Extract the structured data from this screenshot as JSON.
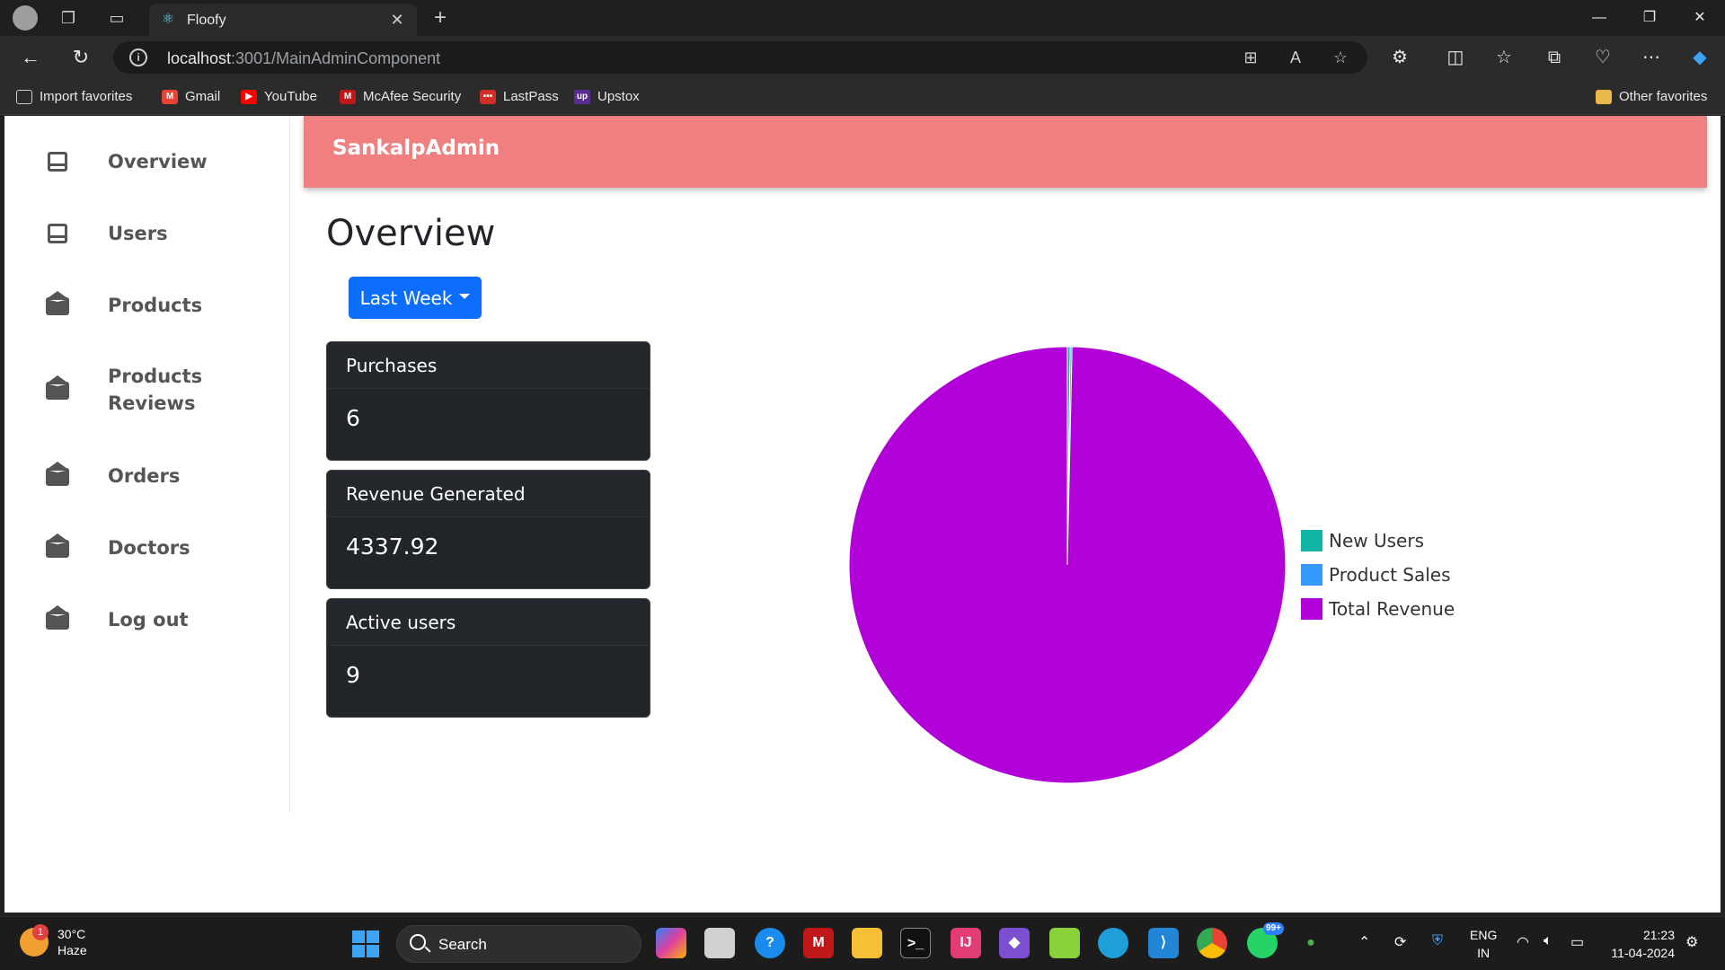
{
  "browser": {
    "tab_title": "Floofy",
    "url_host": "localhost",
    "url_rest": ":3001/MainAdminComponent",
    "favorites": [
      {
        "label": "Import favorites",
        "color": "#2b2b2b",
        "glyph": "⇲"
      },
      {
        "label": "Gmail",
        "color": "#ea4335",
        "glyph": "M"
      },
      {
        "label": "YouTube",
        "color": "#ff0000",
        "glyph": "▶"
      },
      {
        "label": "McAfee Security",
        "color": "#c01818",
        "glyph": "M"
      },
      {
        "label": "LastPass",
        "color": "#d32d27",
        "glyph": "•••"
      },
      {
        "label": "Upstox",
        "color": "#5a2d91",
        "glyph": "up"
      }
    ],
    "other_favorites": "Other favorites"
  },
  "sidebar": {
    "items": [
      {
        "label": "Overview",
        "icon": "inbox-icon"
      },
      {
        "label": "Users",
        "icon": "inbox-icon"
      },
      {
        "label": "Products",
        "icon": "envelope-open-icon"
      },
      {
        "label": "Products Reviews",
        "icon": "envelope-open-icon"
      },
      {
        "label": "Orders",
        "icon": "envelope-open-icon"
      },
      {
        "label": "Doctors",
        "icon": "envelope-open-icon"
      },
      {
        "label": "Log out",
        "icon": "envelope-open-icon"
      }
    ]
  },
  "header": {
    "brand": "SankalpAdmin"
  },
  "main": {
    "title": "Overview",
    "range_dropdown": "Last Week",
    "cards": [
      {
        "label": "Purchases",
        "value": "6"
      },
      {
        "label": "Revenue Generated",
        "value": "4337.92"
      },
      {
        "label": "Active users",
        "value": "9"
      }
    ]
  },
  "chart_data": {
    "type": "pie",
    "categories": [
      "New Users",
      "Product Sales",
      "Total Revenue"
    ],
    "values": [
      9,
      6,
      4337.92
    ],
    "colors": [
      "#12b5a5",
      "#3399ff",
      "#b100d8"
    ],
    "legend_position": "right"
  },
  "taskbar": {
    "temp": "30°C",
    "weather": "Haze",
    "weather_badge": "1",
    "search": "Search",
    "lang_top": "ENG",
    "lang_bottom": "IN",
    "time": "21:23",
    "date": "11-04-2024",
    "whatsapp_badge": "99+"
  }
}
